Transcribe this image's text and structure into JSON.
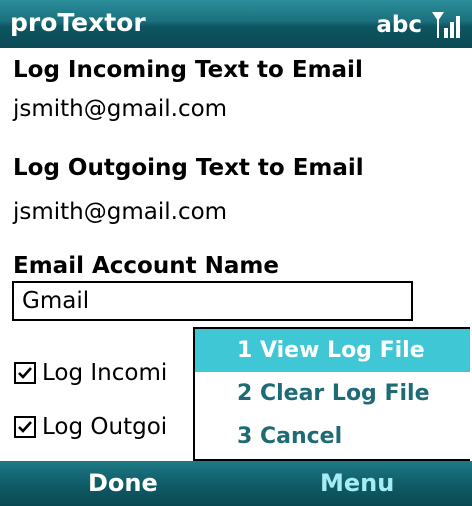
{
  "title_bar": {
    "app_name": "proTextor",
    "input_mode": "abc",
    "icons": [
      "signal-strength-icon"
    ]
  },
  "form": {
    "incoming_label": "Log Incoming Text to Email",
    "incoming_value": "jsmith@gmail.com",
    "outgoing_label": "Log Outgoing Text to Email",
    "outgoing_value": "jsmith@gmail.com",
    "account_label": "Email Account Name",
    "account_value": "Gmail",
    "checkboxes": [
      {
        "label": "Log Incomi",
        "checked": true
      },
      {
        "label": "Log Outgoi",
        "checked": true
      }
    ]
  },
  "menu": {
    "items": [
      {
        "label": "1 View Log File",
        "selected": true
      },
      {
        "label": "2 Clear Log File",
        "selected": false
      },
      {
        "label": "3 Cancel",
        "selected": false
      }
    ]
  },
  "softkeys": {
    "left": "Done",
    "right": "Menu"
  },
  "colors": {
    "title_bar": "#1a6f7c",
    "menu_highlight": "#40c7d6",
    "menu_text": "#1e6b76"
  }
}
